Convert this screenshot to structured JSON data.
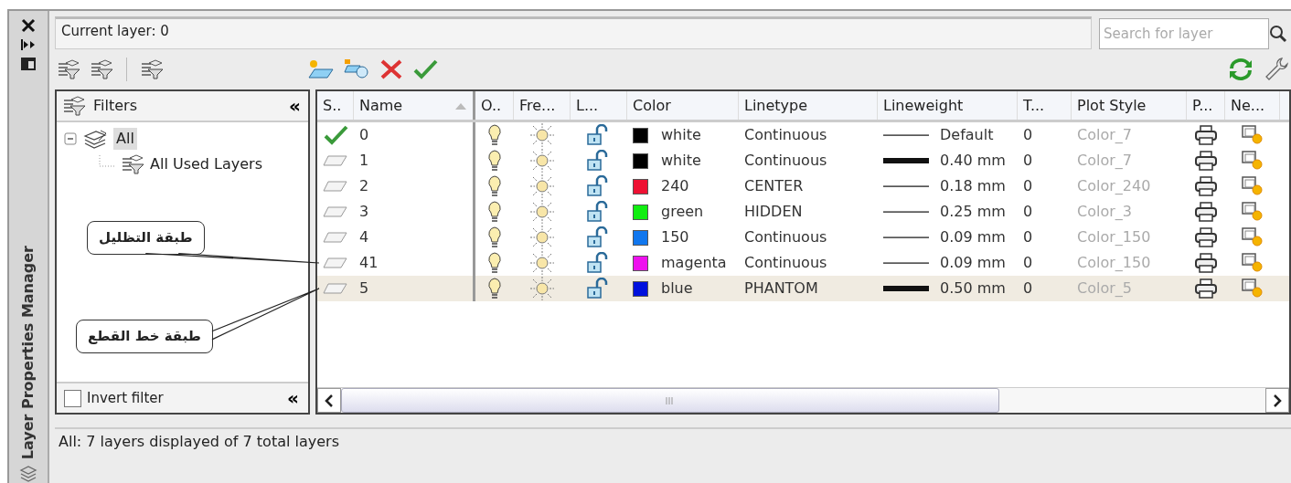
{
  "side_panel": {
    "title": "Layer Properties Manager"
  },
  "current_layer": "Current layer: 0",
  "search": {
    "placeholder": "Search for layer"
  },
  "filters": {
    "title": "Filters",
    "collapse": "«",
    "tree": [
      {
        "label": "All",
        "expanded": true,
        "selected": true,
        "children": [
          {
            "label": "All Used Layers",
            "selected": false
          }
        ]
      }
    ],
    "invert_filter": {
      "label": "Invert filter",
      "checked": false
    },
    "collapse_bottom": "«"
  },
  "table": {
    "columns": [
      {
        "label": "S..",
        "sorted": false
      },
      {
        "label": "Name",
        "sorted": true
      },
      {
        "label": "O..",
        "sorted": false
      },
      {
        "label": "Fre...",
        "sorted": false
      },
      {
        "label": "L...",
        "sorted": false
      },
      {
        "label": "Color",
        "sorted": false
      },
      {
        "label": "Linetype",
        "sorted": false
      },
      {
        "label": "Lineweight",
        "sorted": false
      },
      {
        "label": "T...",
        "sorted": false
      },
      {
        "label": "Plot Style",
        "sorted": false
      },
      {
        "label": "P...",
        "sorted": false
      },
      {
        "label": "Ne...",
        "sorted": false
      }
    ],
    "rows": [
      {
        "current": true,
        "name": "0",
        "color": "#000000",
        "color_name": "white",
        "linetype": "Continuous",
        "heavy_line": false,
        "lineweight": "Default",
        "transparency": "0",
        "plot_style": "Color_7",
        "selected": false
      },
      {
        "current": false,
        "name": "1",
        "color": "#000000",
        "color_name": "white",
        "linetype": "Continuous",
        "heavy_line": true,
        "lineweight": "0.40 mm",
        "transparency": "0",
        "plot_style": "Color_7",
        "selected": false
      },
      {
        "current": false,
        "name": "2",
        "color": "#ee1133",
        "color_name": "240",
        "linetype": "CENTER",
        "heavy_line": false,
        "lineweight": "0.18 mm",
        "transparency": "0",
        "plot_style": "Color_240",
        "selected": false
      },
      {
        "current": false,
        "name": "3",
        "color": "#11ee11",
        "color_name": "green",
        "linetype": "HIDDEN",
        "heavy_line": false,
        "lineweight": "0.25 mm",
        "transparency": "0",
        "plot_style": "Color_3",
        "selected": false
      },
      {
        "current": false,
        "name": "4",
        "color": "#1177ee",
        "color_name": "150",
        "linetype": "Continuous",
        "heavy_line": false,
        "lineweight": "0.09 mm",
        "transparency": "0",
        "plot_style": "Color_150",
        "selected": false
      },
      {
        "current": false,
        "name": "41",
        "color": "#ee11ee",
        "color_name": "magenta",
        "linetype": "Continuous",
        "heavy_line": false,
        "lineweight": "0.09 mm",
        "transparency": "0",
        "plot_style": "Color_150",
        "selected": false,
        "callout": "طبقة التظليل"
      },
      {
        "current": false,
        "name": "5",
        "color": "#0011dd",
        "color_name": "blue",
        "linetype": "PHANTOM",
        "heavy_line": true,
        "lineweight": "0.50 mm",
        "transparency": "0",
        "plot_style": "Color_5",
        "selected": true,
        "callout": "طبقة خط القطع"
      }
    ]
  },
  "status_bar": "All: 7 layers displayed of 7 total layers"
}
